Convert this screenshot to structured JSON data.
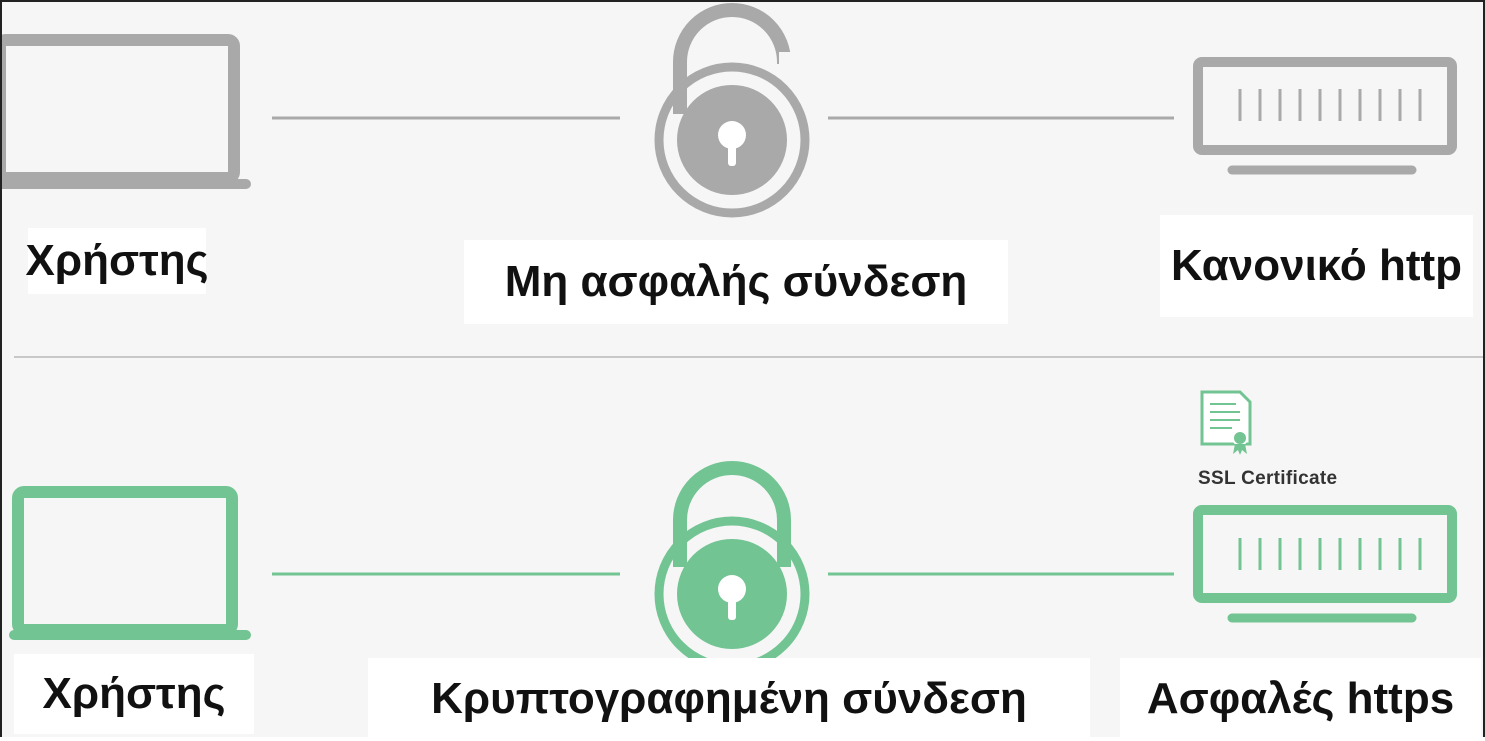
{
  "colors": {
    "insecure": "#a9a9a9",
    "secure": "#72c493",
    "text": "#111111"
  },
  "rows": [
    {
      "name": "insecure",
      "user_label": "Χρήστης",
      "connection_label": "Μη ασφαλής σύνδεση",
      "server_label": "Κανονικό http",
      "icons": [
        "laptop-icon",
        "lock-icon",
        "server-icon"
      ]
    },
    {
      "name": "secure",
      "user_label": "Χρήστης",
      "connection_label": "Κρυπτογραφημένη σύνδεση",
      "server_label": "Ασφαλές https",
      "certificate_label": "SSL Certificate",
      "icons": [
        "laptop-icon",
        "lock-icon",
        "server-icon",
        "certificate-icon"
      ]
    }
  ]
}
